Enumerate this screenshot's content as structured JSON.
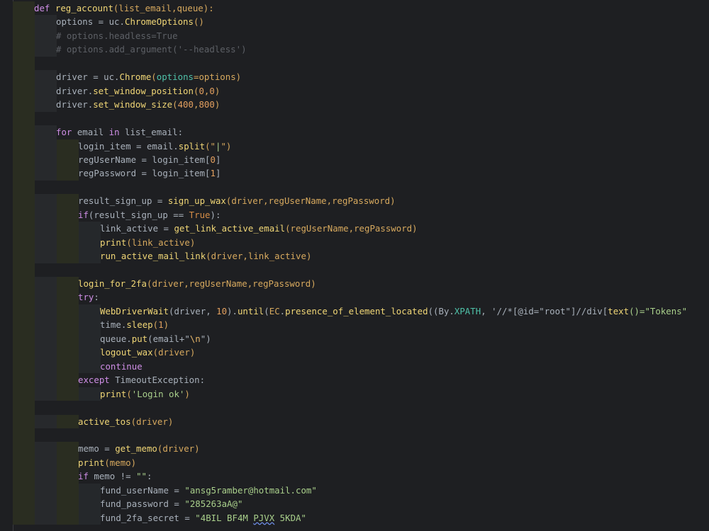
{
  "editor": {
    "language": "python",
    "colors": {
      "background": "#1e1f22",
      "keyword": "#cf8ee6",
      "function": "#f0d676",
      "comment": "#5d6066",
      "string": "#a9cf8b",
      "number": "#e3a05f",
      "parameter": "#4fc1a8"
    },
    "lines": [
      {
        "indent": 0,
        "tokens": [
          [
            "def",
            "kw"
          ],
          [
            " ",
            ""
          ],
          [
            "reg_account",
            "fn"
          ],
          [
            "(list_email,queue):",
            "paren"
          ]
        ]
      },
      {
        "indent": 1,
        "tokens": [
          [
            "options = uc.",
            ""
          ],
          [
            "ChromeOptions",
            "fn"
          ],
          [
            "()",
            "paren"
          ]
        ]
      },
      {
        "indent": 1,
        "tokens": [
          [
            "# options.headless=True",
            "cm"
          ]
        ]
      },
      {
        "indent": 1,
        "tokens": [
          [
            "# options.add_argument('--headless')",
            "cm"
          ]
        ]
      },
      {
        "indent": -1,
        "tokens": []
      },
      {
        "indent": 1,
        "tokens": [
          [
            "driver = uc.",
            ""
          ],
          [
            "Chrome",
            "fn"
          ],
          [
            "(",
            "paren"
          ],
          [
            "options",
            "param"
          ],
          [
            "=options",
            "paren"
          ],
          [
            ")",
            "paren"
          ]
        ]
      },
      {
        "indent": 1,
        "tokens": [
          [
            "driver.",
            ""
          ],
          [
            "set_window_position",
            "fn"
          ],
          [
            "(",
            "paren"
          ],
          [
            "0",
            "num"
          ],
          [
            ",",
            "paren"
          ],
          [
            "0",
            "num"
          ],
          [
            ")",
            "paren"
          ]
        ]
      },
      {
        "indent": 1,
        "tokens": [
          [
            "driver.",
            ""
          ],
          [
            "set_window_size",
            "fn"
          ],
          [
            "(",
            "paren"
          ],
          [
            "400",
            "num"
          ],
          [
            ",",
            "paren"
          ],
          [
            "800",
            "num"
          ],
          [
            ")",
            "paren"
          ]
        ]
      },
      {
        "indent": -1,
        "tokens": []
      },
      {
        "indent": 1,
        "tokens": [
          [
            "for",
            "kw"
          ],
          [
            " email ",
            ""
          ],
          [
            "in",
            "kw"
          ],
          [
            " list_email:",
            ""
          ]
        ]
      },
      {
        "indent": 2,
        "tokens": [
          [
            "login_item = email.",
            ""
          ],
          [
            "split",
            "fn"
          ],
          [
            "(\"",
            "paren"
          ],
          [
            "|",
            "str"
          ],
          [
            "\")",
            "paren"
          ]
        ]
      },
      {
        "indent": 2,
        "tokens": [
          [
            "regUserName = login_item[",
            ""
          ],
          [
            "0",
            "num"
          ],
          [
            "]",
            ""
          ]
        ]
      },
      {
        "indent": 2,
        "tokens": [
          [
            "regPassword = login_item[",
            ""
          ],
          [
            "1",
            "num"
          ],
          [
            "]",
            ""
          ]
        ]
      },
      {
        "indent": -1,
        "tokens": []
      },
      {
        "indent": 2,
        "tokens": [
          [
            "result_sign_up = ",
            ""
          ],
          [
            "sign_up_wax",
            "fn"
          ],
          [
            "(driver,regUserName,regPassword)",
            "paren"
          ]
        ]
      },
      {
        "indent": 2,
        "tokens": [
          [
            "if",
            "kw"
          ],
          [
            "(result_sign_up == ",
            ""
          ],
          [
            "True",
            "bool"
          ],
          [
            "):",
            ""
          ]
        ]
      },
      {
        "indent": 3,
        "tokens": [
          [
            "link_active = ",
            ""
          ],
          [
            "get_link_active_email",
            "fn"
          ],
          [
            "(regUserName,regPassword)",
            "paren"
          ]
        ]
      },
      {
        "indent": 3,
        "tokens": [
          [
            "print",
            "fn"
          ],
          [
            "(link_active)",
            "paren"
          ]
        ]
      },
      {
        "indent": 3,
        "tokens": [
          [
            "run_active_mail_link",
            "fn"
          ],
          [
            "(driver,link_active)",
            "paren"
          ]
        ]
      },
      {
        "indent": -1,
        "tokens": []
      },
      {
        "indent": 2,
        "tokens": [
          [
            "login_for_2fa",
            "fn"
          ],
          [
            "(driver,regUserName,regPassword)",
            "paren"
          ]
        ]
      },
      {
        "indent": 2,
        "tokens": [
          [
            "try",
            "kw"
          ],
          [
            ":",
            ""
          ]
        ]
      },
      {
        "indent": 3,
        "tokens": [
          [
            "WebDriverWait",
            "fn"
          ],
          [
            "(driver, ",
            ""
          ],
          [
            "10",
            "num"
          ],
          [
            ").",
            ""
          ],
          [
            "until",
            "fn"
          ],
          [
            "(",
            ""
          ],
          [
            "EC",
            "paren"
          ],
          [
            ".",
            ""
          ],
          [
            "presence_of_element_located",
            "fn"
          ],
          [
            "((By.",
            ""
          ],
          [
            "XPATH",
            "param"
          ],
          [
            ", '//*[@id=\"root\"]//div[",
            ""
          ],
          [
            "text",
            "fn"
          ],
          [
            "()=\"Tokens\"",
            "str"
          ]
        ]
      },
      {
        "indent": 3,
        "tokens": [
          [
            "time.",
            ""
          ],
          [
            "sleep",
            "fn"
          ],
          [
            "(",
            "paren"
          ],
          [
            "1",
            "num"
          ],
          [
            ")",
            "paren"
          ]
        ]
      },
      {
        "indent": 3,
        "tokens": [
          [
            "queue.",
            ""
          ],
          [
            "put",
            "fn"
          ],
          [
            "(email+\"",
            ""
          ],
          [
            "\\n",
            "esc"
          ],
          [
            "\")",
            ""
          ]
        ]
      },
      {
        "indent": 3,
        "tokens": [
          [
            "logout_wax",
            "fn"
          ],
          [
            "(driver)",
            "paren"
          ]
        ]
      },
      {
        "indent": 3,
        "tokens": [
          [
            "continue",
            "kw"
          ]
        ]
      },
      {
        "indent": 2,
        "tokens": [
          [
            "except",
            "kw"
          ],
          [
            " TimeoutException:",
            ""
          ]
        ]
      },
      {
        "indent": 3,
        "tokens": [
          [
            "print",
            "fn"
          ],
          [
            "(",
            "paren"
          ],
          [
            "'Login ok'",
            "str"
          ],
          [
            ")",
            "paren"
          ]
        ]
      },
      {
        "indent": -1,
        "tokens": []
      },
      {
        "indent": 2,
        "tokens": [
          [
            "active_tos",
            "fn"
          ],
          [
            "(driver)",
            "paren"
          ]
        ]
      },
      {
        "indent": -1,
        "tokens": []
      },
      {
        "indent": 2,
        "tokens": [
          [
            "memo = ",
            ""
          ],
          [
            "get_memo",
            "fn"
          ],
          [
            "(driver)",
            "paren"
          ]
        ]
      },
      {
        "indent": 2,
        "tokens": [
          [
            "print",
            "fn"
          ],
          [
            "(memo)",
            "paren"
          ]
        ]
      },
      {
        "indent": 2,
        "tokens": [
          [
            "if",
            "kw"
          ],
          [
            " memo != ",
            ""
          ],
          [
            "\"\"",
            "str"
          ],
          [
            ":",
            ""
          ]
        ]
      },
      {
        "indent": 3,
        "tokens": [
          [
            "fund_userName = ",
            ""
          ],
          [
            "\"ansg5ramber@hotmail.com\"",
            "str"
          ]
        ]
      },
      {
        "indent": 3,
        "tokens": [
          [
            "fund_password = ",
            ""
          ],
          [
            "\"285263aA@\"",
            "str"
          ]
        ]
      },
      {
        "indent": 3,
        "tokens": [
          [
            "fund_2fa_secret = ",
            ""
          ],
          [
            "\"4BIL BF4M ",
            "str"
          ],
          [
            "PJVX",
            "str wave"
          ],
          [
            " 5KDA\"",
            "str"
          ]
        ]
      }
    ]
  }
}
